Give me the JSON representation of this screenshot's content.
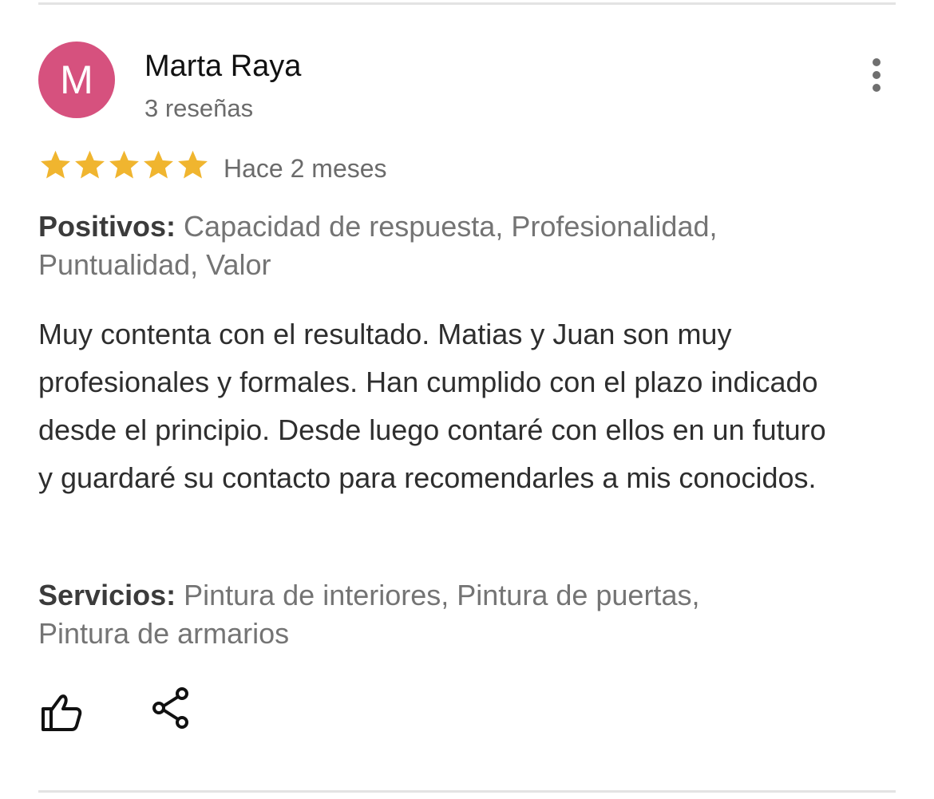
{
  "review": {
    "author": {
      "initial": "M",
      "name": "Marta Raya",
      "review_count": "3 reseñas",
      "avatar_color": "#d6517e"
    },
    "rating": {
      "stars": 5,
      "max_stars": 5,
      "star_color": "#f0b52f"
    },
    "date": "Hace 2 meses",
    "positives": {
      "label": "Positivos:",
      "value": " Capacidad de respuesta, Profesionalidad, Puntualidad, Valor"
    },
    "text": "Muy contenta con el resultado. Matias y Juan son muy profesionales y formales. Han cumplido con el plazo indicado desde el principio. Desde luego contaré con ellos en un futuro y guardaré su contacto para recomendarles a mis conocidos.",
    "services": {
      "label": "Servicios:",
      "value": " Pintura de interiores, Pintura de puertas, Pintura de armarios"
    },
    "actions": {
      "like_icon": "thumbs-up-icon",
      "share_icon": "share-icon",
      "more_icon": "more-vertical-icon"
    }
  }
}
